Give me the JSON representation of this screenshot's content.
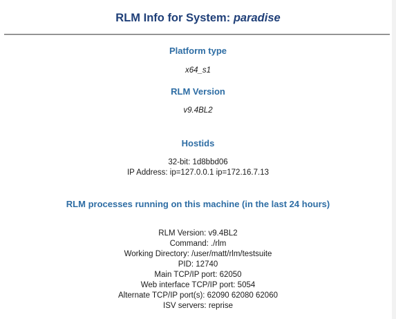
{
  "header": {
    "title_prefix": "RLM Info for System: ",
    "system_name": "paradise"
  },
  "platform": {
    "heading": "Platform type",
    "value": "x64_s1"
  },
  "version": {
    "heading": "RLM Version",
    "value": "v9.4BL2"
  },
  "hostids": {
    "heading": "Hostids",
    "lines": [
      "32-bit: 1d8bbd06",
      "IP Address: ip=127.0.0.1 ip=172.16.7.13"
    ]
  },
  "processes": {
    "heading": "RLM processes running on this machine (in the last 24 hours)",
    "lines": [
      "RLM Version: v9.4BL2",
      "Command: ./rlm",
      "Working Directory: /user/matt/rlm/testsuite",
      "PID: 12740",
      "Main TCP/IP port: 62050",
      "Web interface TCP/IP port: 5054",
      "Alternate TCP/IP port(s): 62090 62080 62060",
      "ISV servers: reprise"
    ]
  }
}
